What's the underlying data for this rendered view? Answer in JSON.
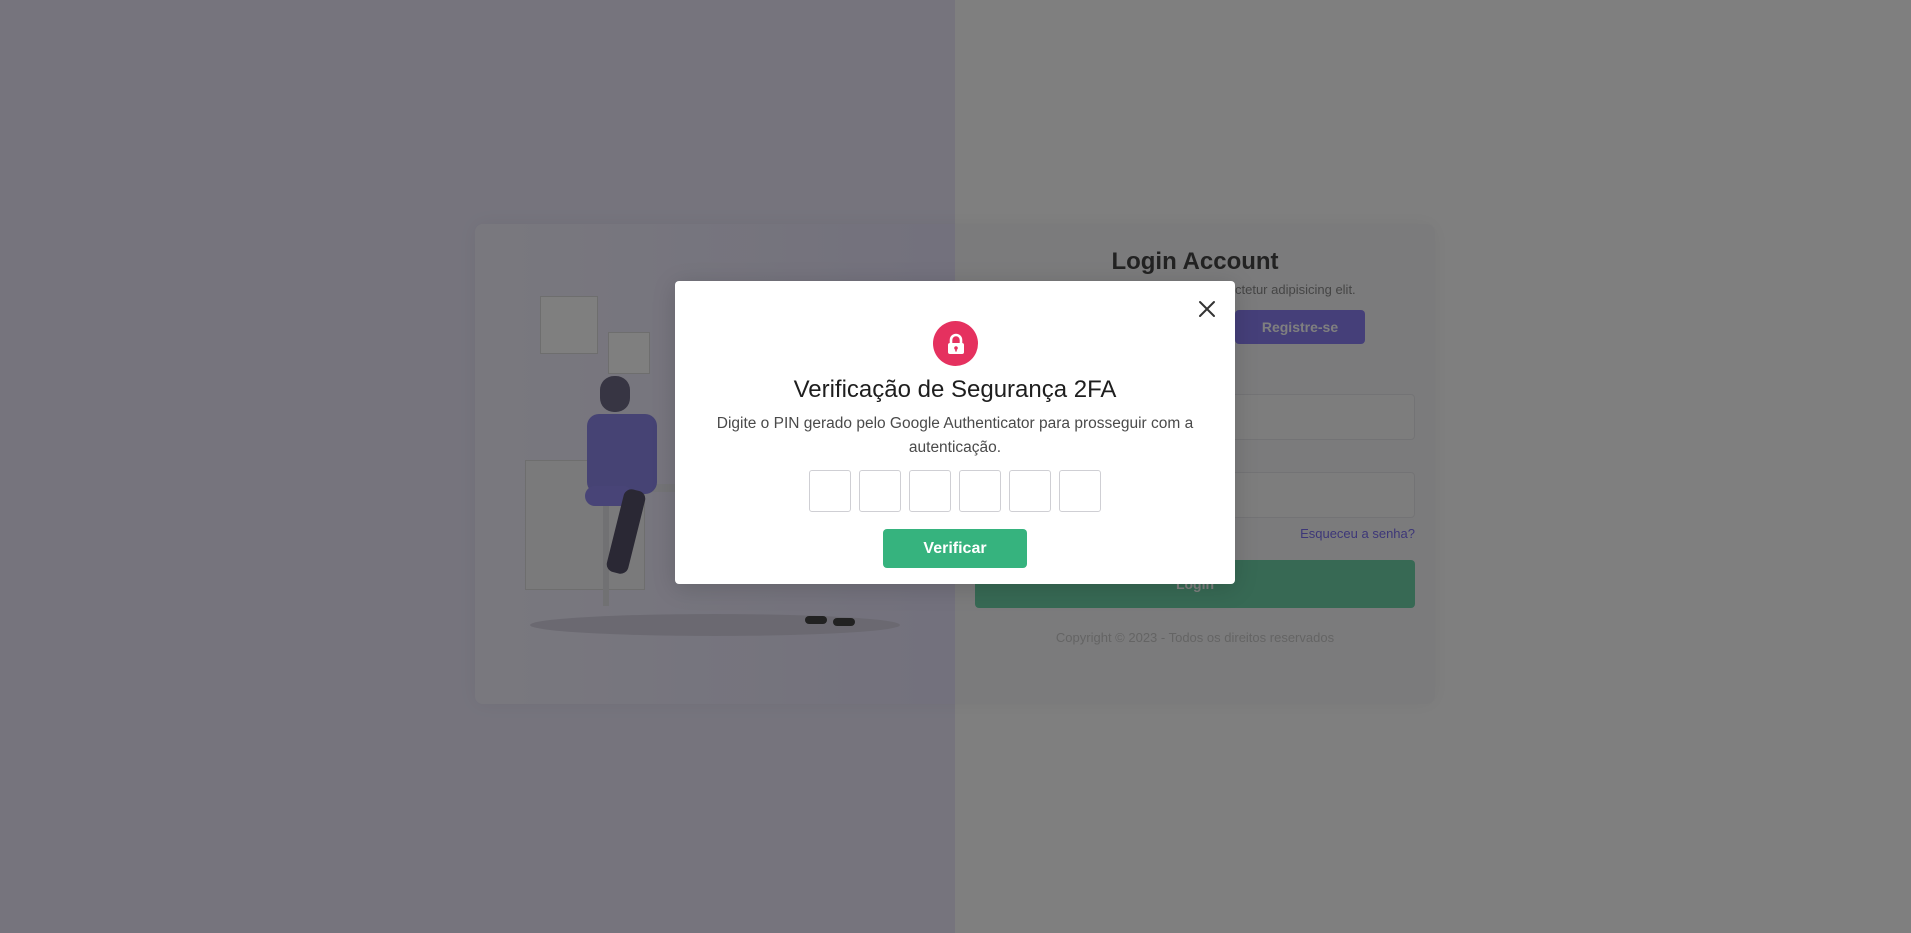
{
  "login": {
    "title": "Login Account",
    "subtitle_partial": "ctetur adipisicing elit.",
    "register_label": "Registre-se",
    "forgot_label": "Esqueceu a senha?",
    "login_label": "Login",
    "copyright": "Copyright © 2023 - Todos os direitos reservados"
  },
  "modal": {
    "icon": "lock-icon",
    "title": "Verificação de Segurança 2FA",
    "description": "Digite o PIN gerado pelo Google Authenticator para prosseguir com a autenticação.",
    "pin_values": [
      "",
      "",
      "",
      "",
      "",
      ""
    ],
    "verify_label": "Verificar",
    "close_icon": "close-icon"
  },
  "colors": {
    "accent_red": "#e5315f",
    "button_green": "#36b37e",
    "overlay": "rgba(0,0,0,0.5)",
    "purple": "#8a7ff3"
  }
}
